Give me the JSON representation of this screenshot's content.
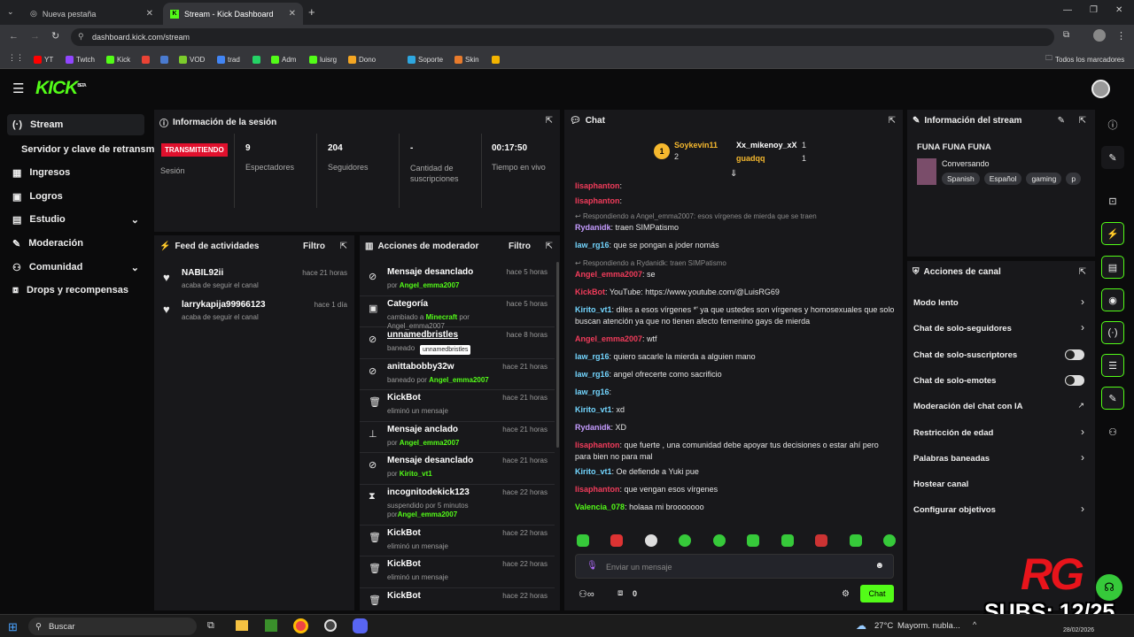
{
  "browser": {
    "tabs": [
      {
        "label": "Nueva pestaña"
      },
      {
        "label": "Stream - Kick Dashboard"
      }
    ],
    "url": "dashboard.kick.com/stream",
    "bookmarks": [
      "YT",
      "Twtch",
      "Kick",
      "M",
      "",
      "VOD",
      "trad",
      "",
      "Adm",
      "luisrg",
      "Dono",
      "Soporte",
      "Skin",
      ""
    ],
    "all_bookmarks": "Todos los marcadores"
  },
  "brand": {
    "logo": "KICK",
    "beta": "BETA",
    "accent": "#53fc18"
  },
  "sidebar": {
    "items": [
      {
        "label": "Stream"
      },
      {
        "label": "Servidor y clave de retransm"
      },
      {
        "label": "Ingresos"
      },
      {
        "label": "Logros"
      },
      {
        "label": "Estudio"
      },
      {
        "label": "Moderación"
      },
      {
        "label": "Comunidad"
      },
      {
        "label": "Drops y recompensas"
      }
    ]
  },
  "session": {
    "title": "Información de la sesión",
    "status": "TRANSMITIENDO",
    "status_label": "Sesión",
    "stats": [
      {
        "value": "9",
        "label": "Espectadores"
      },
      {
        "value": "204",
        "label": "Seguidores"
      },
      {
        "value": "-",
        "label": "Cantidad de suscripciones"
      },
      {
        "value": "00:17:50",
        "label": "Tiempo en vivo"
      }
    ]
  },
  "feed": {
    "title": "Feed de actividades",
    "filter": "Filtro",
    "items": [
      {
        "name": "NABIL92ii",
        "sub": "acaba de seguir el canal",
        "time": "hace 21 horas"
      },
      {
        "name": "larrykapija99966123",
        "sub": "acaba de seguir el canal",
        "time": "hace 1 día"
      }
    ]
  },
  "modactions": {
    "title": "Acciones de moderador",
    "filter": "Filtro",
    "tooltip": "unnamedbristles",
    "items": [
      {
        "title": "Mensaje desanclado",
        "pre": "por ",
        "user": "Angel_emma2007",
        "post": "",
        "time": "hace 5 horas"
      },
      {
        "title": "Categoría",
        "pre": "cambiado a ",
        "user": "Minecraft",
        "post": " por Angel_emma2007",
        "time": "hace 5 horas"
      },
      {
        "title": "unnamedbristles",
        "pre": "baneado",
        "user": "",
        "post": "",
        "time": "hace 8 horas"
      },
      {
        "title": "anittabobby32w",
        "pre": "baneado por ",
        "user": "Angel_emma2007",
        "post": "",
        "time": "hace 21 horas"
      },
      {
        "title": "KickBot",
        "pre": "eliminó un mensaje",
        "user": "",
        "post": "",
        "time": "hace 21 horas"
      },
      {
        "title": "Mensaje anclado",
        "pre": "por ",
        "user": "Angel_emma2007",
        "post": "",
        "time": "hace 21 horas"
      },
      {
        "title": "Mensaje desanclado",
        "pre": "por ",
        "user": "Kirito_vt1",
        "post": "",
        "time": "hace 21 horas"
      },
      {
        "title": "incognitodekick123",
        "pre": "suspendido por 5 minutos por",
        "user": "Angel_emma2007",
        "post": "",
        "time": "hace 22 horas"
      },
      {
        "title": "KickBot",
        "pre": "eliminó un mensaje",
        "user": "",
        "post": "",
        "time": "hace 22 horas"
      },
      {
        "title": "KickBot",
        "pre": "eliminó un mensaje",
        "user": "",
        "post": "",
        "time": "hace 22 horas"
      },
      {
        "title": "KickBot",
        "pre": "",
        "user": "",
        "post": "",
        "time": "hace 22 horas"
      }
    ]
  },
  "chat": {
    "title": "Chat",
    "top": [
      {
        "rank": "1",
        "name": "Soykevin11",
        "count": "2"
      },
      {
        "name": "Xx_mikenoy_xX",
        "count": "1"
      },
      {
        "name": "guadqq",
        "count": "1"
      }
    ],
    "messages": [
      {
        "user": "lisaphanton",
        "color": "#f23c5b",
        "text": ":",
        "reply": ""
      },
      {
        "user": "lisaphanton",
        "color": "#f23c5b",
        "text": ":",
        "reply": ""
      },
      {
        "user": "Rydanidk",
        "color": "#c59cff",
        "text": ": traen SIMPatismo",
        "reply": "Respondiendo a Angel_emma2007: esos vírgenes de mierda que se traen"
      },
      {
        "user": "law_rg16",
        "color": "#73d6ff",
        "text": ": que se pongan a joder nomás",
        "reply": ""
      },
      {
        "user": "Angel_emma2007",
        "color": "#f23c5b",
        "text": ": se",
        "reply": "Respondiendo a Rydanidk: traen SIMPatismo"
      },
      {
        "user": "KickBot",
        "color": "#f23c5b",
        "text": ": YouTube: https://www.youtube.com/@LuisRG69",
        "reply": ""
      },
      {
        "user": "Kirito_vt1",
        "color": "#73d6ff",
        "text": ": diles a esos vírgenes *' ya que ustedes son vírgenes y homosexuales que solo buscan atención ya que no tienen afecto femenino gays de mierda",
        "reply": ""
      },
      {
        "user": "Angel_emma2007",
        "color": "#f23c5b",
        "text": ": wtf",
        "reply": ""
      },
      {
        "user": "law_rg16",
        "color": "#73d6ff",
        "text": ": quiero sacarle la mierda a alguien mano",
        "reply": ""
      },
      {
        "user": "law_rg16",
        "color": "#73d6ff",
        "text": ": angel ofrecerte como sacrificio",
        "reply": ""
      },
      {
        "user": "law_rg16",
        "color": "#73d6ff",
        "text": ":",
        "reply": ""
      },
      {
        "user": "Kirito_vt1",
        "color": "#73d6ff",
        "text": ": xd",
        "reply": ""
      },
      {
        "user": "Rydanidk",
        "color": "#c59cff",
        "text": ": XD",
        "reply": ""
      },
      {
        "user": "lisaphanton",
        "color": "#f23c5b",
        "text": ": que fuerte , una comunidad debe apoyar tus decisiones o estar ahí pero para bien no para mal",
        "reply": ""
      },
      {
        "user": "Kirito_vt1",
        "color": "#73d6ff",
        "text": ": Oe defiende a Yuki pue",
        "reply": ""
      },
      {
        "user": "lisaphanton",
        "color": "#f23c5b",
        "text": ": que vengan esos vírgenes",
        "reply": ""
      },
      {
        "user": "Valencia_078",
        "color": "#53fc18",
        "text": ": holaaa mi brooooooo",
        "reply": ""
      }
    ],
    "placeholder": "Enviar un mensaje",
    "points": "0",
    "send": "Chat"
  },
  "streaminfo": {
    "title": "Información del stream",
    "stream_title": "FUNA FUNA FUNA",
    "category": "Conversando",
    "tags": [
      "Spanish",
      "Español",
      "gaming",
      "p"
    ]
  },
  "channel": {
    "title": "Acciones de canal",
    "items": [
      {
        "label": "Modo lento",
        "ctl": "chevron"
      },
      {
        "label": "Chat de solo-seguidores",
        "ctl": "chevron"
      },
      {
        "label": "Chat de solo-suscriptores",
        "ctl": "toggle"
      },
      {
        "label": "Chat de solo-emotes",
        "ctl": "toggle"
      },
      {
        "label": "Moderación del chat con IA",
        "ctl": "ext"
      },
      {
        "label": "Restricción de edad",
        "ctl": "chevron"
      },
      {
        "label": "Palabras baneadas",
        "ctl": "chevron"
      },
      {
        "label": "Hostear canal",
        "ctl": ""
      },
      {
        "label": "Configurar objetivos",
        "ctl": "chevron"
      }
    ]
  },
  "overlay": {
    "logo": "RG",
    "subs": "SUBS: 12/25"
  },
  "taskbar": {
    "search": "Buscar",
    "weather": "27°C",
    "weather_text": "Mayorm. nubla...",
    "date": "28/02/2026"
  }
}
